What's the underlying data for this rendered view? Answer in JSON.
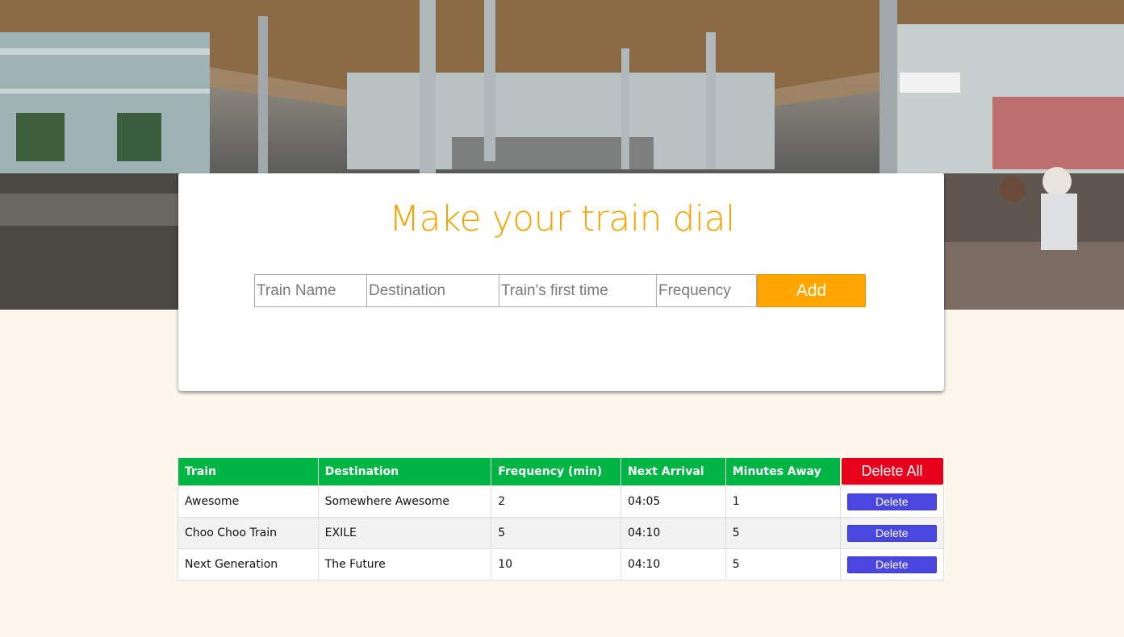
{
  "hero": {
    "image": "train-station-interior"
  },
  "header": {
    "title": "Make your train dial"
  },
  "form": {
    "train_name_placeholder": "Train Name",
    "destination_placeholder": "Destination",
    "first_time_placeholder": "Train's first time",
    "frequency_placeholder": "Frequency",
    "add_label": "Add"
  },
  "table": {
    "headers": [
      "Train",
      "Destination",
      "Frequency (min)",
      "Next Arrival",
      "Minutes Away"
    ],
    "delete_all_label": "Delete All",
    "delete_label": "Delete",
    "rows": [
      {
        "train": "Awesome",
        "destination": "Somewhere Awesome",
        "frequency": "2",
        "next_arrival": "04:05",
        "minutes_away": "1"
      },
      {
        "train": "Choo Choo Train",
        "destination": "EXILE",
        "frequency": "5",
        "next_arrival": "04:10",
        "minutes_away": "5"
      },
      {
        "train": "Next Generation",
        "destination": "The Future",
        "frequency": "10",
        "next_arrival": "04:10",
        "minutes_away": "5"
      }
    ]
  },
  "colors": {
    "accent": "#f5a300",
    "header_green": "#00b543",
    "delete_all_red": "#e8001b",
    "delete_blue": "#4a47e0",
    "page_bg": "#fdf6ec"
  }
}
